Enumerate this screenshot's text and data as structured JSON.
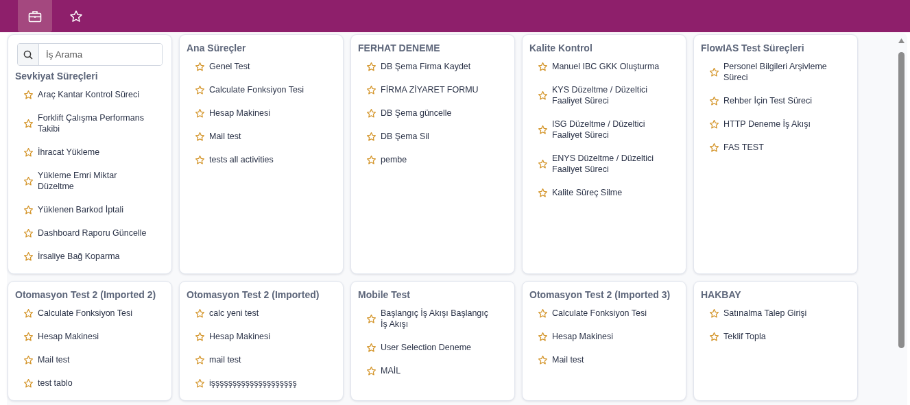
{
  "top_bar": {
    "nav": [
      {
        "kind": "briefcase",
        "selected": true
      },
      {
        "kind": "star",
        "selected": false
      }
    ]
  },
  "menu": {
    "search": {
      "placeholder": "İş Arama"
    },
    "groups": [
      {
        "title": "Sevkiyat Süreçleri",
        "items": [
          {
            "label": "Araç Kantar Kontrol Süreci",
            "starred": false
          },
          {
            "label": "Forklift Çalışma Performans Takibi",
            "starred": false
          },
          {
            "label": "İhracat Yükleme",
            "starred": false
          },
          {
            "label": "Yükleme Emri Miktar Düzeltme",
            "starred": false
          },
          {
            "label": "Yüklenen Barkod İptali",
            "starred": false
          },
          {
            "label": "Dashboard Raporu Güncelle",
            "starred": false
          },
          {
            "label": "İrsaliye Bağ Koparma",
            "starred": false
          }
        ]
      },
      {
        "title": "Ana Süreçler",
        "items": [
          {
            "label": "Genel Test",
            "starred": false
          },
          {
            "label": "Calculate Fonksiyon Tesi",
            "starred": false
          },
          {
            "label": "Hesap Makinesi",
            "starred": false
          },
          {
            "label": "Mail test",
            "starred": false
          },
          {
            "label": "tests all activities",
            "starred": false
          }
        ]
      },
      {
        "title": "FERHAT DENEME",
        "items": [
          {
            "label": "DB Şema Firma Kaydet",
            "starred": false
          },
          {
            "label": "FİRMA ZİYARET FORMU",
            "starred": false
          },
          {
            "label": "DB Şema güncelle",
            "starred": false
          },
          {
            "label": "DB Şema Sil",
            "starred": false
          },
          {
            "label": "pembe",
            "starred": false
          }
        ]
      },
      {
        "title": "Kalite Kontrol",
        "items": [
          {
            "label": "Manuel IBC GKK Oluşturma",
            "starred": false
          },
          {
            "label": "KYS Düzeltme / Düzeltici Faaliyet Süreci",
            "starred": false
          },
          {
            "label": "ISG Düzeltme / Düzeltici Faaliyet Süreci",
            "starred": false
          },
          {
            "label": "ENYS Düzeltme / Düzeltici Faaliyet Süreci",
            "starred": false
          },
          {
            "label": "Kalite Süreç Silme",
            "starred": false
          }
        ]
      },
      {
        "title": "FlowIAS Test Süreçleri",
        "items": [
          {
            "label": "Personel Bilgileri Arşivleme Süreci",
            "starred": false
          },
          {
            "label": "Rehber İçin Test Süreci",
            "starred": false
          },
          {
            "label": "HTTP Deneme İş Akışı",
            "starred": false
          },
          {
            "label": "FAS TEST",
            "starred": false
          }
        ]
      },
      {
        "title": "Otomasyon Test 2 (Imported 2)",
        "items": [
          {
            "label": "Calculate Fonksiyon Tesi",
            "starred": false
          },
          {
            "label": "Hesap Makinesi",
            "starred": false
          },
          {
            "label": "Mail test",
            "starred": false
          },
          {
            "label": "test tablo",
            "starred": false
          }
        ]
      },
      {
        "title": "Otomasyon Test 2 (Imported)",
        "items": [
          {
            "label": "calc yeni test",
            "starred": false
          },
          {
            "label": "Hesap Makinesi",
            "starred": false
          },
          {
            "label": "mail test",
            "starred": false
          },
          {
            "label": "işşşşşşşşşşşşşşşşşşşş",
            "starred": false
          }
        ]
      },
      {
        "title": "Mobile Test",
        "items": [
          {
            "label": "Başlangıç İş Akışı Başlangıç İş Akışı",
            "starred": false
          },
          {
            "label": "User Selection Deneme",
            "starred": false
          },
          {
            "label": "MAİL",
            "starred": false
          }
        ]
      },
      {
        "title": "Otomasyon Test 2 (Imported 3)",
        "items": [
          {
            "label": "Calculate Fonksiyon Tesi",
            "starred": false
          },
          {
            "label": "Hesap Makinesi",
            "starred": false
          },
          {
            "label": "Mail test",
            "starred": false
          }
        ]
      },
      {
        "title": "HAKBAY",
        "items": [
          {
            "label": "Satınalma Talep Girişi",
            "starred": false
          },
          {
            "label": "Teklif Topla",
            "starred": false
          }
        ]
      }
    ]
  }
}
